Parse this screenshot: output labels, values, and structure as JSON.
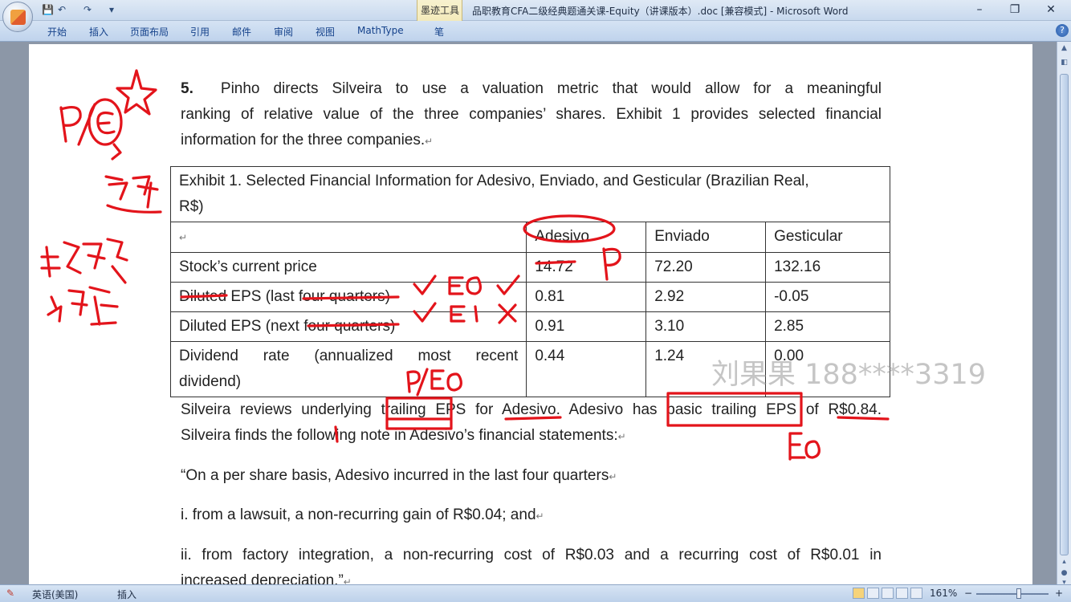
{
  "window": {
    "title": "品职教育CFA二级经典题通关课-Equity（讲课版本）.doc [兼容模式] - Microsoft Word",
    "contextual_group": "墨迹工具",
    "minimize": "–",
    "restore": "❐",
    "close": "✕"
  },
  "quick_access": {
    "save": "💾",
    "undo": "↶",
    "redo": "↷",
    "customize": "▾"
  },
  "ribbon": {
    "tabs": [
      "开始",
      "插入",
      "页面布局",
      "引用",
      "邮件",
      "审阅",
      "视图",
      "MathType",
      "笔"
    ],
    "help": "?"
  },
  "document": {
    "q_number": "5.",
    "q_line1": "Pinho directs Silveira to use a valuation metric that would allow for a meaningful",
    "q_line2": "ranking of relative value of the three companies’ shares. Exhibit 1 provides selected financial",
    "q_line3": "information for the three companies.",
    "exhibit_title_1": "Exhibit 1. Selected Financial Information for Adesivo, Enviado, and Gesticular (Brazilian Real,",
    "exhibit_title_2": "R$)",
    "columns": [
      "Adesivo",
      "Enviado",
      "Gesticular"
    ],
    "rows": [
      {
        "label": "Stock’s current price",
        "values": [
          "14.72",
          "72.20",
          "132.16"
        ]
      },
      {
        "label": "Diluted EPS (last four quarters)",
        "values": [
          "0.81",
          "2.92",
          "-0.05"
        ]
      },
      {
        "label": "Diluted EPS (next four quarters)",
        "values": [
          "0.91",
          "3.10",
          "2.85"
        ]
      },
      {
        "label_1": "Dividend rate (annualized most recent",
        "label_2": "dividend)",
        "values": [
          "0.44",
          "1.24",
          "0.00"
        ]
      }
    ],
    "p2_line1": "Silveira reviews underlying trailing EPS for Adesivo. Adesivo has basic trailing EPS of R$0.84.",
    "p2_line2": "Silveira finds the following note in Adesivo’s financial statements:",
    "p3": "“On a per share basis, Adesivo incurred in the last four quarters",
    "p4": "i. from a lawsuit, a non-recurring gain of R$0.04; and",
    "p5_line1": "ii. from factory integration, a non-recurring cost of R$0.03 and a recurring cost of R$0.01 in",
    "p5_line2": "increased depreciation.”",
    "paragraph_mark": "↵",
    "watermark": "刘果果 188****3319"
  },
  "statusbar": {
    "language": "英语(美国)",
    "insert_mode": "插入",
    "zoom": "161%",
    "zoom_out": "−",
    "zoom_in": "+"
  },
  "colors": {
    "ink": "#e3141b",
    "ribbon": "#bfd3ec",
    "workspace": "#8c97a7"
  }
}
